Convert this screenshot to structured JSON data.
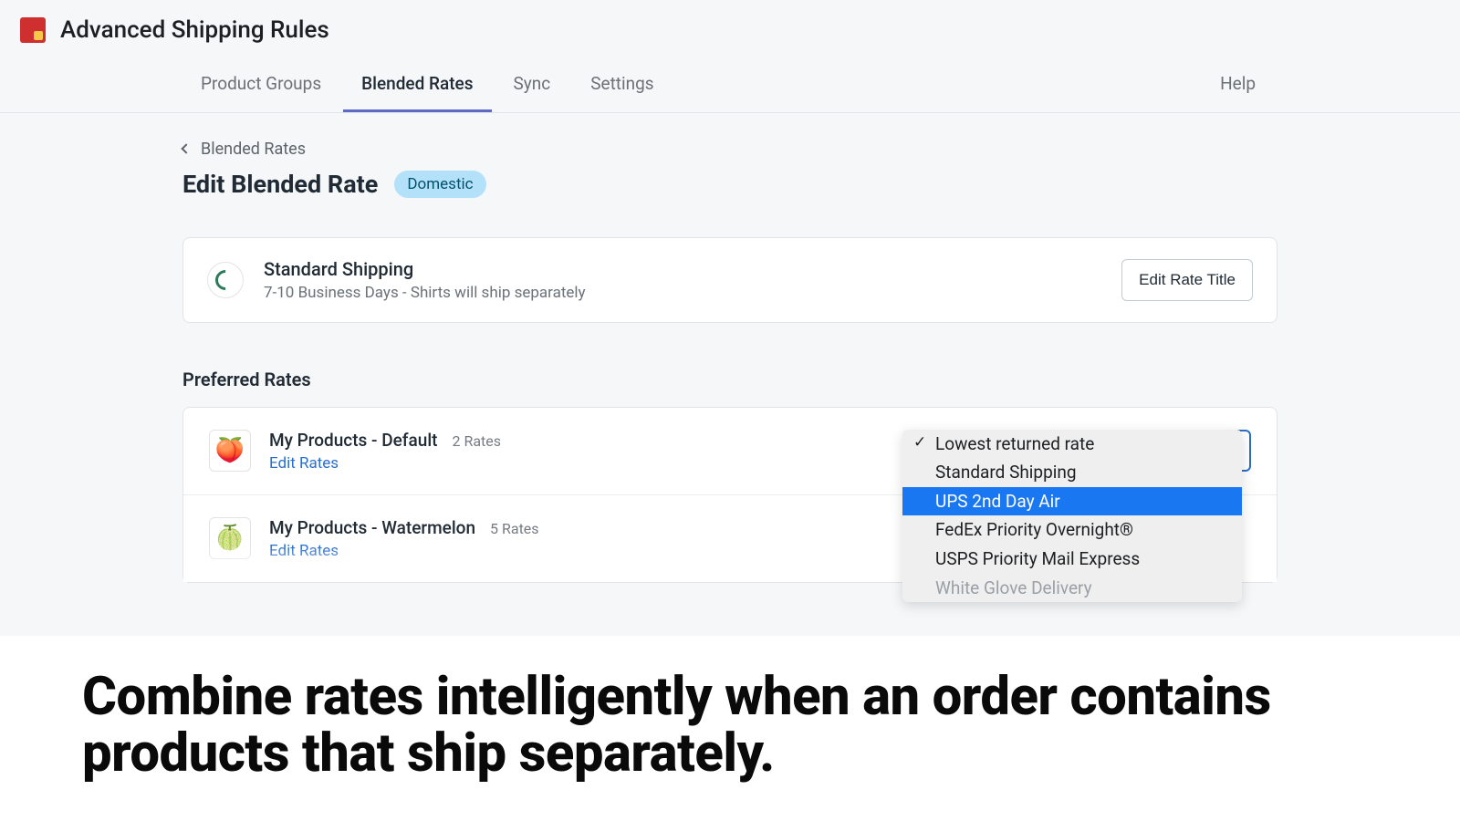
{
  "header": {
    "app_title": "Advanced Shipping Rules"
  },
  "tabs": {
    "items": [
      "Product Groups",
      "Blended Rates",
      "Sync",
      "Settings"
    ],
    "help": "Help",
    "active_index": 1
  },
  "breadcrumb": {
    "label": "Blended Rates"
  },
  "page": {
    "title": "Edit Blended Rate",
    "badge": "Domestic"
  },
  "rate_card": {
    "title": "Standard Shipping",
    "subtitle": "7-10 Business Days - Shirts will ship separately",
    "edit_button": "Edit Rate Title"
  },
  "preferred": {
    "section_title": "Preferred Rates",
    "rows": [
      {
        "title": "My Products - Default",
        "count": "2 Rates",
        "edit": "Edit Rates",
        "icon": "🍑"
      },
      {
        "title": "My Products - Watermelon",
        "count": "5 Rates",
        "edit": "Edit Rates",
        "icon": "🍈"
      }
    ]
  },
  "dropdown": {
    "options": [
      "Lowest returned rate",
      "Standard Shipping",
      "UPS 2nd Day Air",
      "FedEx Priority Overnight®",
      "USPS Priority Mail Express",
      "White Glove Delivery"
    ],
    "selected_index": 0,
    "highlight_index": 2
  },
  "tagline": "Combine rates intelligently when an order contains products that ship separately."
}
